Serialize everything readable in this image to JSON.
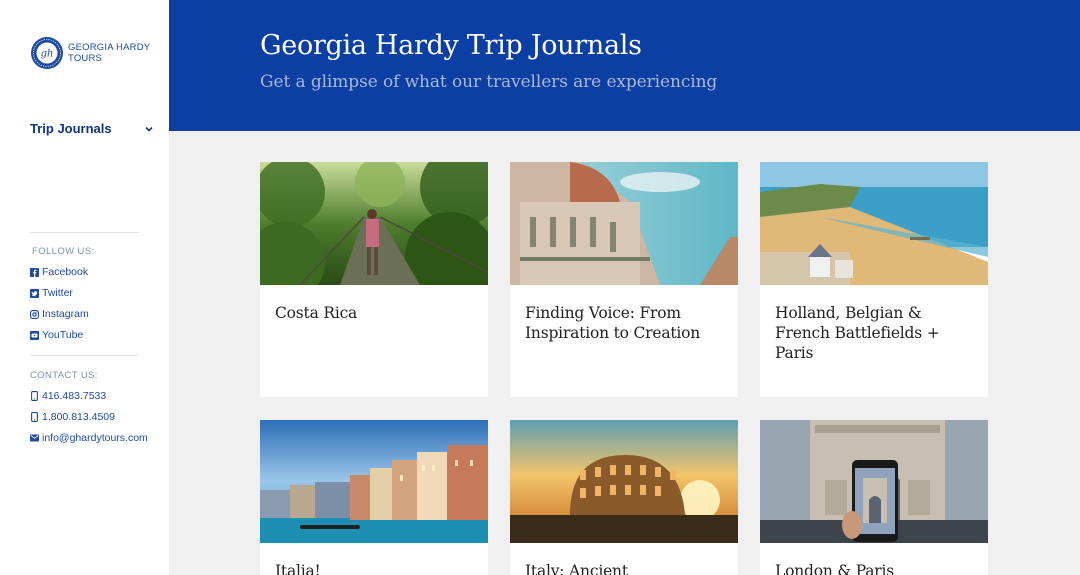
{
  "brand": {
    "name_line1": "GEORGIA HARDY",
    "name_line2": "TOURS",
    "monogram": "gh",
    "color": "#0b3fa3"
  },
  "sidebar": {
    "nav": {
      "label": "Trip Journals",
      "icon": "chevron-down-icon"
    },
    "follow_label": "FOLLOW US:",
    "social": [
      {
        "label": "Facebook",
        "icon": "facebook-icon"
      },
      {
        "label": "Twitter",
        "icon": "twitter-icon"
      },
      {
        "label": "Instagram",
        "icon": "instagram-icon"
      },
      {
        "label": "YouTube",
        "icon": "youtube-icon"
      }
    ],
    "contact_label": "CONTACT US:",
    "contacts": [
      {
        "label": "416.483.7533",
        "icon": "phone-icon"
      },
      {
        "label": "1.800.813.4509",
        "icon": "phone-icon"
      },
      {
        "label": "info@ghardytours.com",
        "icon": "envelope-icon"
      }
    ]
  },
  "header": {
    "title": "Georgia Hardy Trip Journals",
    "subtitle": "Get a glimpse of what our travellers are experiencing"
  },
  "cards": [
    {
      "title": "Costa Rica",
      "image": "rainforest suspension bridge"
    },
    {
      "title": "Finding Voice: From Inspiration to Creation",
      "image": "florence cathedral"
    },
    {
      "title": "Holland, Belgian & French Battlefields + Paris",
      "image": "normandy beach"
    },
    {
      "title": "Italia!",
      "image": "venice grand canal"
    },
    {
      "title": "Italy: Ancient",
      "image": "colosseum at sunset"
    },
    {
      "title": "London & Paris",
      "image": "arc de triomphe phone photo"
    }
  ]
}
